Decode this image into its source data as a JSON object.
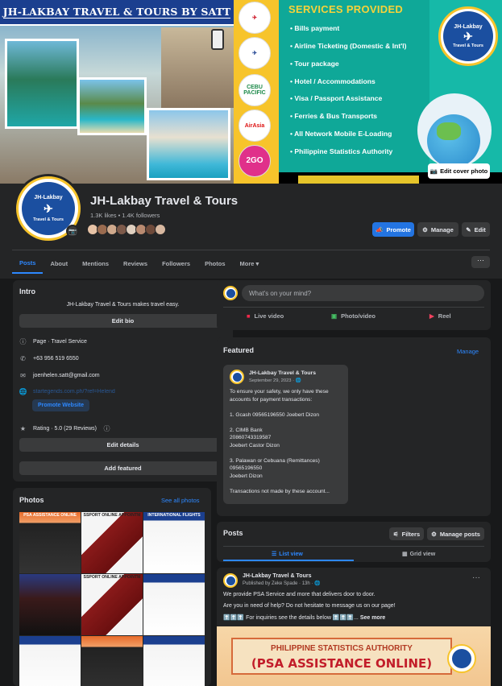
{
  "cover": {
    "title": "JH-LAKBAY TRAVEL & TOURS BY SATT",
    "services_title": "SERVICES PROVIDED",
    "services": [
      "Bills payment",
      "Airline Ticketing (Domestic & Int'l)",
      "Tour package",
      "Hotel / Accommodations",
      "Visa / Passport Assistance",
      "Ferries & Bus Transports",
      "All Network Mobile E-Loading",
      "Philippine Statistics Authority"
    ],
    "partner_logos": [
      "CEBU PACIFIC",
      "AirAsia",
      "2GO"
    ],
    "brand_logo": {
      "line1": "JH-Lakbay",
      "line2": "Travel & Tours"
    },
    "edit_cover_label": "Edit cover photo"
  },
  "profile": {
    "name": "JH-Lakbay Travel & Tours",
    "stats": "1.3K likes • 1.4K followers",
    "avatar": {
      "line1": "JH-Lakbay",
      "line2": "Travel & Tours"
    },
    "friend_colors": [
      "#e7c3a6",
      "#9a6b4f",
      "#cfa98c",
      "#7d5a4a",
      "#e0d0c0",
      "#b98a70",
      "#6e4a3a",
      "#d8b8a0"
    ],
    "buttons": {
      "promote": "Promote",
      "manage": "Manage",
      "edit": "Edit"
    }
  },
  "tabs": [
    "Posts",
    "About",
    "Mentions",
    "Reviews",
    "Followers",
    "Photos",
    "More ▾"
  ],
  "intro": {
    "title": "Intro",
    "bio": "JH-Lakbay Travel & Tours makes travel easy.",
    "edit_bio": "Edit bio",
    "category": "Page · Travel Service",
    "phone": "+63 956 519 6550",
    "email": "joenhelen.satt@gmail.com",
    "website": "startegends.com.ph/?ref=Helend",
    "promote_website": "Promote Website",
    "rating": "Rating · 5.0 (29 Reviews)",
    "edit_details": "Edit details",
    "add_featured": "Add featured"
  },
  "photos": {
    "title": "Photos",
    "see_all": "See all photos",
    "tile_titles": [
      "PSA ASSISTANCE ONLINE",
      "SSPORT ONLINE APPOINTM",
      "INTERNATIONAL FLIGHTS",
      "",
      "SSPORT ONLINE APPOINTM",
      "",
      "",
      "",
      ""
    ]
  },
  "composer": {
    "placeholder": "What's on your mind?",
    "live_video": "Live video",
    "photo_video": "Photo/video",
    "reel": "Reel"
  },
  "featured": {
    "title": "Featured",
    "manage": "Manage",
    "author": "JH-Lakbay Travel & Tours",
    "date": "September 29, 2023 · 🌐",
    "body": "To ensure your safety, we only have these accounts for payment transactions:\n\n1. Gcash 09565196550 Joebert Dizon\n\n2. CIMB Bank\n20860743319587\nJoebert Castor Dizon\n\n3. Palawan or Cebuana (Remittances)\n09565196550\nJoebert Dizon\n\nTransactions not made by these account..."
  },
  "posts": {
    "title": "Posts",
    "filters": "Filters",
    "manage_posts": "Manage posts",
    "list_view": "List view",
    "grid_view": "Grid view"
  },
  "post": {
    "author": "JH-Lakbay Travel & Tours",
    "meta": "Published by Zeke Spade · 13h · 🌐",
    "line1": "We provide PSA Service and more that delivers door to door.",
    "line2": "Are you in need of help? Do not hesitate to message us on our page!",
    "line3": "⬆️⬆️⬆️ For inquiries see the details below ⬆️⬆️⬆️...",
    "see_more": "See more",
    "banner_line1": "PHILIPPINE STATISTICS AUTHORITY",
    "banner_line2": "(PSA ASSISTANCE ONLINE)"
  },
  "colors": {
    "accent": "#2d88ff",
    "primary_button": "#2374e1",
    "background": "#18191a",
    "card": "#242526"
  }
}
